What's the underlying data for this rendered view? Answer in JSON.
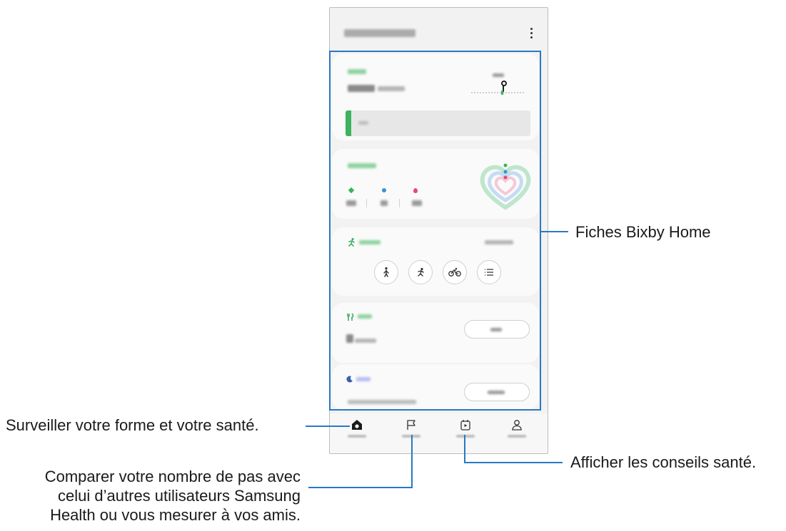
{
  "callouts": {
    "cards_label": "Fiches Bixby Home",
    "home_label": "Surveiller votre forme et votre santé.",
    "together_line1": "Comparer votre nombre de pas avec",
    "together_line2": "celui d’autres utilisateurs Samsung",
    "together_line3": "Health ou vous mesurer à vos amis.",
    "discover_label": "Afficher les conseils santé."
  },
  "icons": {
    "more": "more-vertical-icon",
    "walk": "walk-icon",
    "run": "run-icon",
    "bike": "bike-icon",
    "list": "list-icon",
    "food": "fork-knife-icon",
    "sleep": "moon-icon",
    "home": "home-icon",
    "together": "flag-icon",
    "discover": "play-calendar-icon",
    "profile": "person-icon"
  },
  "colors": {
    "accent_line": "#2a78c4",
    "steps_green": "#3cb35c",
    "activity_blue": "#3a8fd8",
    "activity_pink": "#e8457a",
    "sleep_blue": "#6f7ad8"
  },
  "steps_progress_fraction": 0.03
}
